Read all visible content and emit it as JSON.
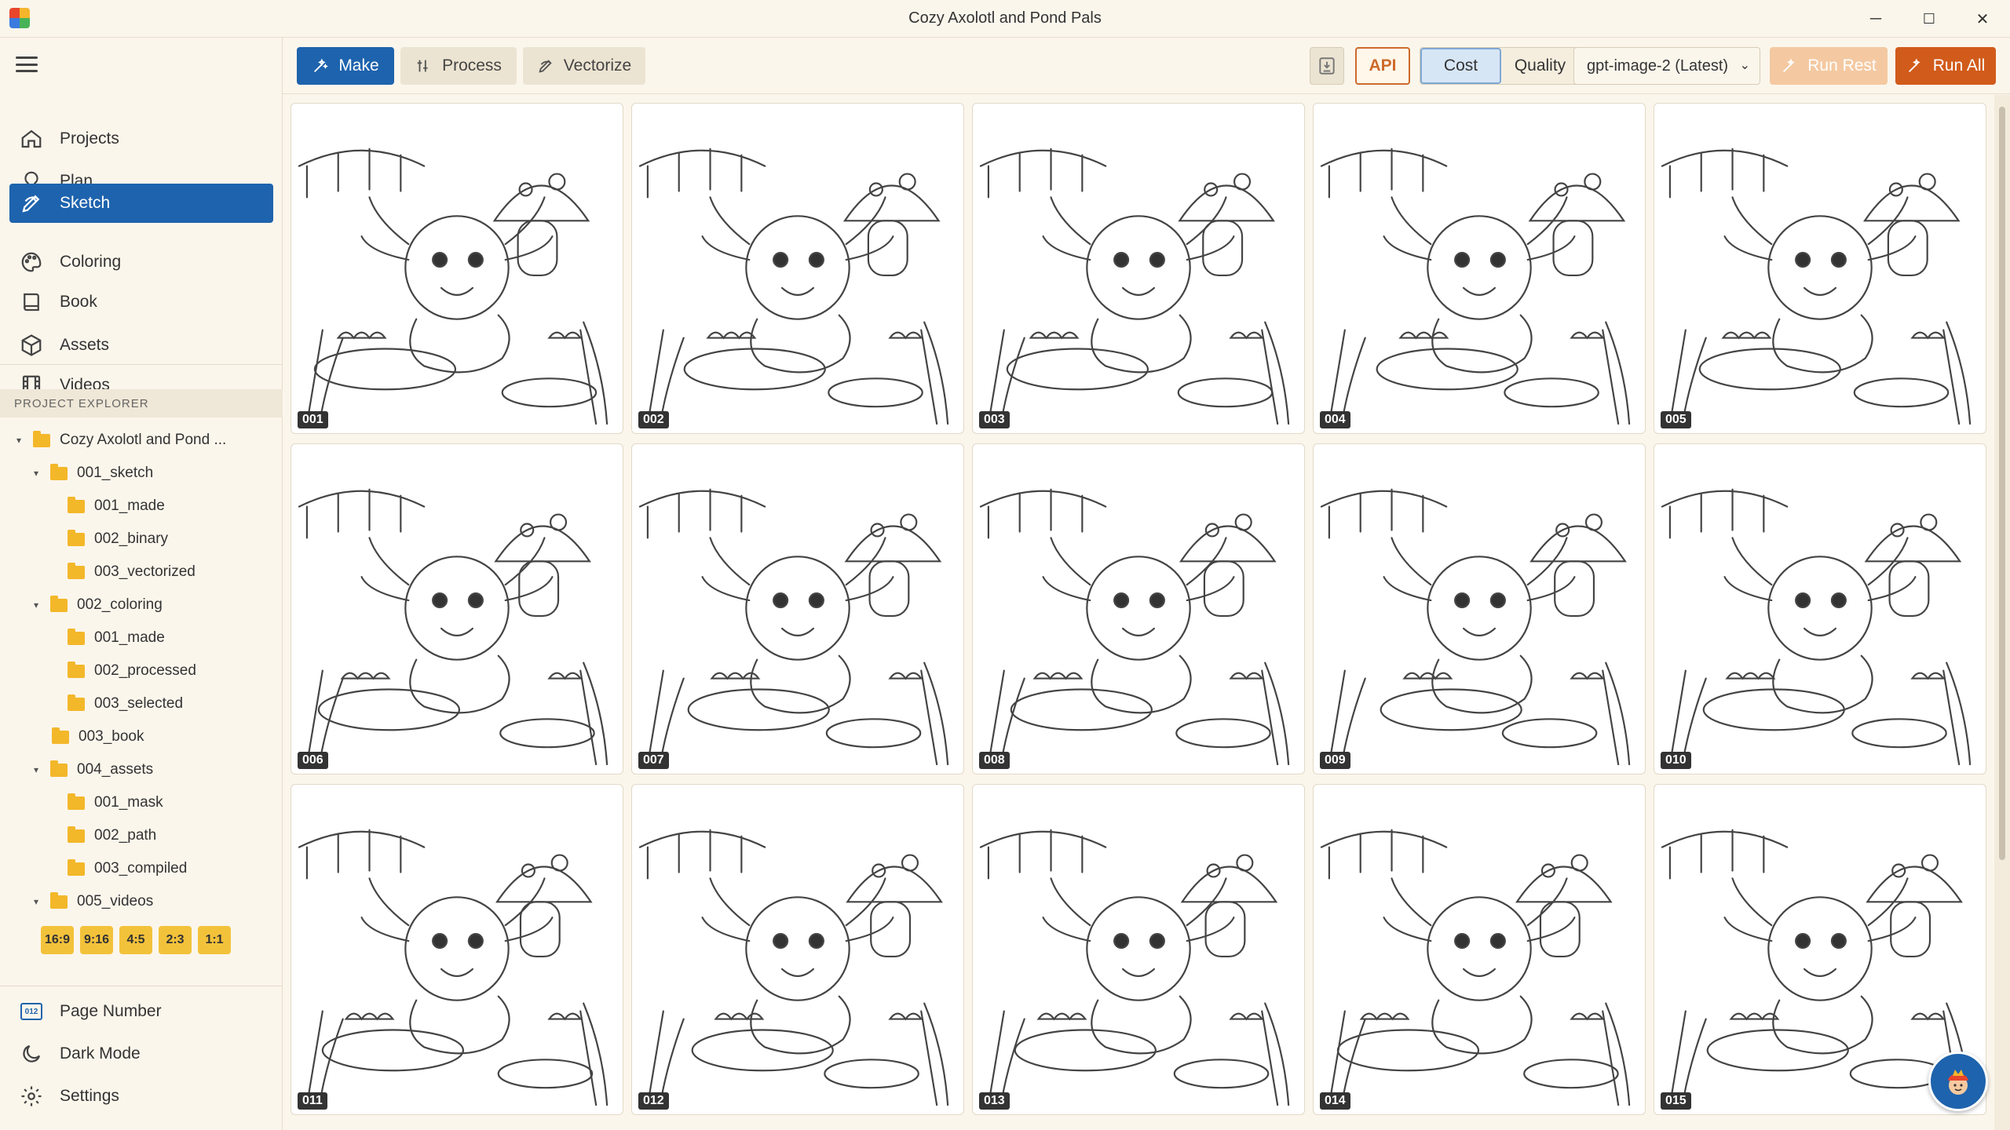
{
  "window": {
    "title": "Cozy Axolotl and Pond Pals",
    "minimize": "─",
    "maximize": "☐",
    "close": "✕"
  },
  "nav": {
    "items": [
      {
        "label": "Projects",
        "icon": "home-icon"
      },
      {
        "label": "Plan",
        "icon": "lightbulb-icon"
      },
      {
        "label": "Sketch",
        "icon": "pencil-icon",
        "active": true
      },
      {
        "label": "Coloring",
        "icon": "palette-icon"
      },
      {
        "label": "Book",
        "icon": "book-icon"
      },
      {
        "label": "Assets",
        "icon": "cube-icon"
      },
      {
        "label": "Videos",
        "icon": "film-icon"
      }
    ]
  },
  "explorer": {
    "header": "PROJECT EXPLORER",
    "tree": [
      {
        "label": "Cozy Axolotl and Pond ...",
        "level": 0,
        "caret": "▾"
      },
      {
        "label": "001_sketch",
        "level": 1,
        "caret": "▾"
      },
      {
        "label": "001_made",
        "level": 2,
        "caret": ""
      },
      {
        "label": "002_binary",
        "level": 2,
        "caret": ""
      },
      {
        "label": "003_vectorized",
        "level": 2,
        "caret": ""
      },
      {
        "label": "002_coloring",
        "level": 1,
        "caret": "▾"
      },
      {
        "label": "001_made",
        "level": 2,
        "caret": ""
      },
      {
        "label": "002_processed",
        "level": 2,
        "caret": ""
      },
      {
        "label": "003_selected",
        "level": 2,
        "caret": ""
      },
      {
        "label": "003_book",
        "level": 1,
        "caret": ""
      },
      {
        "label": "004_assets",
        "level": 1,
        "caret": "▾"
      },
      {
        "label": "001_mask",
        "level": 2,
        "caret": ""
      },
      {
        "label": "002_path",
        "level": 2,
        "caret": ""
      },
      {
        "label": "003_compiled",
        "level": 2,
        "caret": ""
      },
      {
        "label": "005_videos",
        "level": 1,
        "caret": "▾"
      }
    ],
    "ratios": [
      "16:9",
      "9:16",
      "4:5",
      "2:3",
      "1:1"
    ]
  },
  "bottom_nav": [
    {
      "label": "Page Number",
      "icon": "page-number-icon",
      "badge": "012"
    },
    {
      "label": "Dark Mode",
      "icon": "moon-icon"
    },
    {
      "label": "Settings",
      "icon": "gear-icon"
    }
  ],
  "toolbar": {
    "make": "Make",
    "process": "Process",
    "vectorize": "Vectorize",
    "api": "API",
    "cost": "Cost",
    "quality": "Quality",
    "model": "gpt-image-2 (Latest)",
    "run_rest": "Run Rest",
    "run_all": "Run All"
  },
  "gallery": {
    "pages": [
      "001",
      "002",
      "003",
      "004",
      "005",
      "006",
      "007",
      "008",
      "009",
      "010",
      "011",
      "012",
      "013",
      "014",
      "015"
    ]
  },
  "colors": {
    "accent": "#1e63ad",
    "run_all": "#d15b1b",
    "folder": "#f3b72a",
    "ratio": "#f3c23b",
    "background": "#fbf6ec"
  }
}
